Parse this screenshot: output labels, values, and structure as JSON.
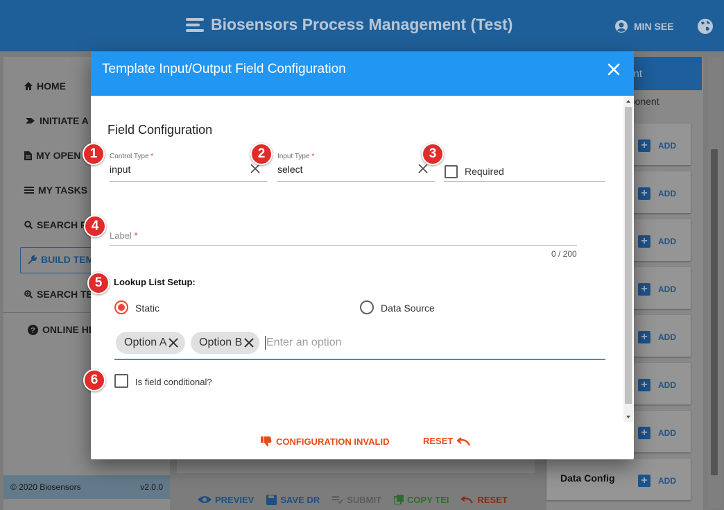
{
  "app": {
    "title": "Biosensors Process Management (Test)",
    "user_name": "MIN SEE",
    "icons": {
      "menu": "bars-icon",
      "user": "user-circle-icon",
      "globe": "globe-icon"
    }
  },
  "sidebar": {
    "items": [
      {
        "label": "HOME",
        "icon": "home-icon"
      },
      {
        "label": "INITIATE A",
        "icon": "chevron-icon"
      },
      {
        "label": "MY OPEN",
        "icon": "file-icon"
      },
      {
        "label": "MY TASKS",
        "icon": "list-icon"
      },
      {
        "label": "SEARCH P",
        "icon": "search-icon"
      },
      {
        "label": "BUILD TEMI",
        "icon": "wrench-icon"
      },
      {
        "label": "SEARCH TE",
        "icon": "search-plus-icon"
      },
      {
        "label": "ONLINE HE",
        "icon": "question-icon"
      }
    ],
    "footer_copyright": "© 2020 Biosensors",
    "footer_version": "v2.0.0"
  },
  "center_toolbar": {
    "preview": "PREVIEV",
    "save": "SAVE DR",
    "submit": "SUBMIT",
    "copy": "COPY TEI",
    "reset": "RESET"
  },
  "right_panel": {
    "header_text": "nt",
    "subheader": "nponent",
    "add_label": "ADD",
    "last_card_name": "Data Config"
  },
  "modal": {
    "title": "Template Input/Output Field Configuration",
    "section_title": "Field Configuration",
    "control_type": {
      "label": "Control Type",
      "required_mark": "*",
      "value": "input"
    },
    "input_type": {
      "label": "Input Type",
      "required_mark": "*",
      "value": "select"
    },
    "required_checkbox": {
      "label": "Required",
      "checked": false
    },
    "label_field": {
      "label": "Label",
      "required_mark": "*",
      "value": "",
      "counter": "0 / 200"
    },
    "lookup": {
      "title": "Lookup List Setup:",
      "radio_static": "Static",
      "radio_data_source": "Data Source",
      "selected": "Static",
      "chips": [
        "Option A",
        "Option B"
      ],
      "input_placeholder": "Enter an option"
    },
    "conditional_checkbox": {
      "label": "Is field conditional?",
      "checked": false
    },
    "actions": {
      "invalid_label": "CONFIGURATION INVALID",
      "reset_label": "RESET"
    }
  },
  "callouts": [
    "1",
    "2",
    "3",
    "4",
    "5",
    "6"
  ],
  "colors": {
    "modal_header": "#2196f3",
    "accent_orange": "#e64a19",
    "radio_selected": "#f44336",
    "callout_red": "#e02b2b"
  }
}
